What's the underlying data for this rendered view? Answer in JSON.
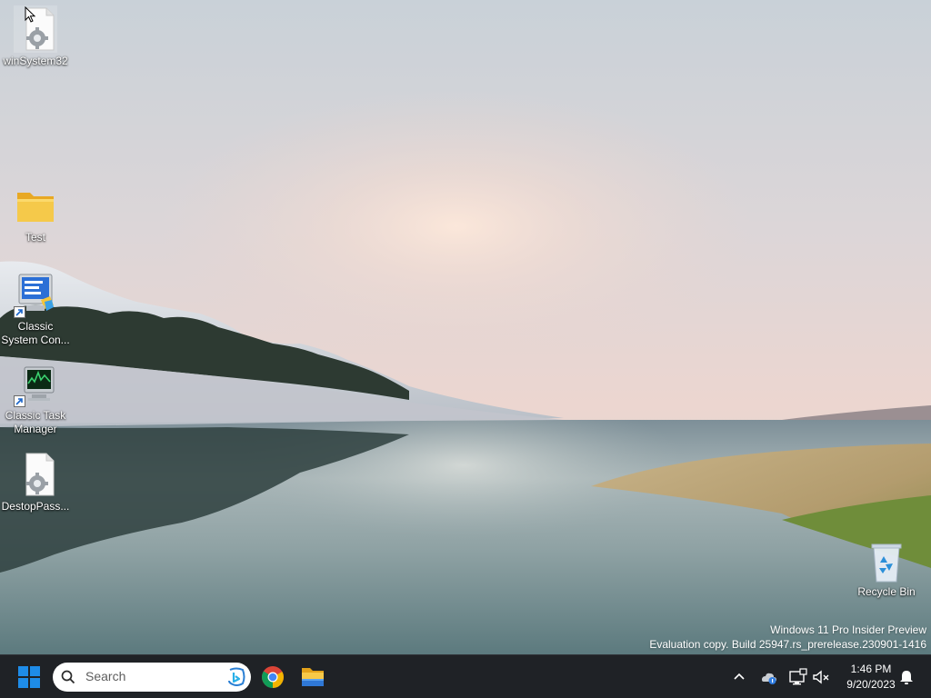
{
  "desktop": {
    "icons": [
      {
        "label": "winSystem32"
      },
      {
        "label": "Test"
      },
      {
        "label": "Classic System Con..."
      },
      {
        "label": "Classic Task Manager"
      },
      {
        "label": "DestopPass..."
      },
      {
        "label": "Recycle Bin"
      }
    ],
    "watermark": {
      "line1": "Windows 11 Pro Insider Preview",
      "line2": "Evaluation copy. Build 25947.rs_prerelease.230901-1416"
    }
  },
  "taskbar": {
    "search_placeholder": "Search",
    "clock_time": "1:46 PM",
    "clock_date": "9/20/2023",
    "pinned": [
      "start-icon",
      "chrome-icon",
      "file-explorer-icon"
    ],
    "tray_icons": [
      "chevron-up-icon",
      "onedrive-icon",
      "network-icon",
      "volume-muted-icon",
      "notification-bell-icon"
    ]
  },
  "colors": {
    "taskbar_bg": "#1f2226",
    "start_blue": "#1e8ce8",
    "folder_yellow": "#f5c94a"
  }
}
